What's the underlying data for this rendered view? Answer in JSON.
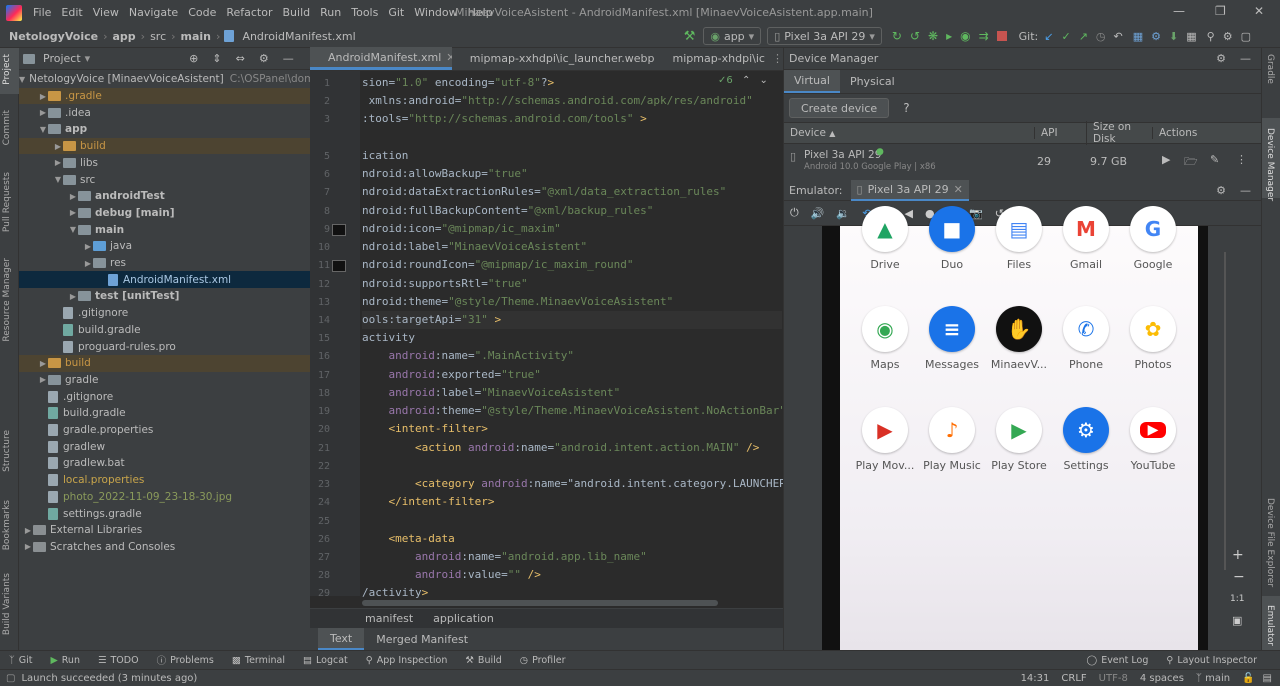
{
  "menubar": {
    "items": [
      "File",
      "Edit",
      "View",
      "Navigate",
      "Code",
      "Refactor",
      "Build",
      "Run",
      "Tools",
      "Git",
      "Window",
      "Help"
    ],
    "title": "MinaevVoiceAsistent - AndroidManifest.xml [MinaevVoiceAsistent.app.main]"
  },
  "navbar": {
    "crumbs": [
      "NetologyVoice",
      "app",
      "src",
      "main",
      "AndroidManifest.xml"
    ],
    "run_config": "app",
    "device": "Pixel 3a API 29",
    "git_label": "Git:"
  },
  "left_tools": [
    "Project",
    "Commit",
    "Pull Requests",
    "Resource Manager",
    "Structure",
    "Bookmarks",
    "Build Variants"
  ],
  "right_tools": [
    "Gradle",
    "Device Manager",
    "Device File Explorer",
    "Emulator"
  ],
  "project": {
    "header": "Project",
    "tree": [
      {
        "label": "NetologyVoice [MinaevVoiceAsistent]",
        "extra": "C:\\OSPanel\\doma",
        "indent": 0,
        "kind": "folder"
      },
      {
        "label": ".gradle",
        "indent": 1,
        "kind": "orange"
      },
      {
        "label": ".idea",
        "indent": 1,
        "kind": "folder"
      },
      {
        "label": "app",
        "indent": 1,
        "kind": "folder",
        "bold": true
      },
      {
        "label": "build",
        "indent": 2,
        "kind": "orange"
      },
      {
        "label": "libs",
        "indent": 2,
        "kind": "folder"
      },
      {
        "label": "src",
        "indent": 2,
        "kind": "folder"
      },
      {
        "label": "androidTest",
        "indent": 3,
        "kind": "folder",
        "bold": true
      },
      {
        "label": "debug [main]",
        "indent": 3,
        "kind": "folder",
        "bold": true
      },
      {
        "label": "main",
        "indent": 3,
        "kind": "folder",
        "bold": true
      },
      {
        "label": "java",
        "indent": 4,
        "kind": "blue"
      },
      {
        "label": "res",
        "indent": 4,
        "kind": "folder"
      },
      {
        "label": "AndroidManifest.xml",
        "indent": 5,
        "kind": "xml"
      },
      {
        "label": "test [unitTest]",
        "indent": 3,
        "kind": "folder",
        "bold": true
      },
      {
        "label": ".gitignore",
        "indent": 2,
        "kind": "file"
      },
      {
        "label": "build.gradle",
        "indent": 2,
        "kind": "grd"
      },
      {
        "label": "proguard-rules.pro",
        "indent": 2,
        "kind": "file"
      },
      {
        "label": "build",
        "indent": 1,
        "kind": "orange"
      },
      {
        "label": "gradle",
        "indent": 1,
        "kind": "folder"
      },
      {
        "label": ".gitignore",
        "indent": 1,
        "kind": "file"
      },
      {
        "label": "build.gradle",
        "indent": 1,
        "kind": "grd"
      },
      {
        "label": "gradle.properties",
        "indent": 1,
        "kind": "file"
      },
      {
        "label": "gradlew",
        "indent": 1,
        "kind": "file"
      },
      {
        "label": "gradlew.bat",
        "indent": 1,
        "kind": "file"
      },
      {
        "label": "local.properties",
        "indent": 1,
        "kind": "file",
        "color": "#c8a54b"
      },
      {
        "label": "photo_2022-11-09_23-18-30.jpg",
        "indent": 1,
        "kind": "file",
        "color": "#8a9a5b"
      },
      {
        "label": "settings.gradle",
        "indent": 1,
        "kind": "grd"
      },
      {
        "label": "External Libraries",
        "indent": 0,
        "kind": "lib"
      },
      {
        "label": "Scratches and Consoles",
        "indent": 0,
        "kind": "lib"
      }
    ]
  },
  "editor": {
    "tabs": [
      "AndroidManifest.xml",
      "mipmap-xxhdpi\\ic_launcher.webp",
      "mipmap-xhdpi\\ic"
    ],
    "warnings": "6",
    "lines": [
      "1",
      "2",
      "3",
      "",
      "5",
      "6",
      "7",
      "8",
      "9",
      "10",
      "11",
      "12",
      "13",
      "14",
      "15",
      "16",
      "17",
      "18",
      "19",
      "20",
      "21",
      "22",
      "23",
      "24",
      "25",
      "26",
      "27",
      "28",
      "29"
    ],
    "code": [
      "sion=\"1.0\" encoding=\"utf-8\"?>",
      " xmlns:android=\"http://schemas.android.com/apk/res/android\"",
      ":tools=\"http://schemas.android.com/tools\" >",
      "",
      "ication",
      "ndroid:allowBackup=\"true\"",
      "ndroid:dataExtractionRules=\"@xml/data_extraction_rules\"",
      "ndroid:fullBackupContent=\"@xml/backup_rules\"",
      "ndroid:icon=\"@mipmap/ic_maxim\"",
      "ndroid:label=\"MinaevVoiceAsistent\"",
      "ndroid:roundIcon=\"@mipmap/ic_maxim_round\"",
      "ndroid:supportsRtl=\"true\"",
      "ndroid:theme=\"@style/Theme.MinaevVoiceAsistent\"",
      "ools:targetApi=\"31\" >",
      "activity",
      "    android:name=\".MainActivity\"",
      "    android:exported=\"true\"",
      "    android:label=\"MinaevVoiceAsistent\"",
      "    android:theme=\"@style/Theme.MinaevVoiceAsistent.NoActionBar\"",
      "    <intent-filter>",
      "        <action android:name=\"android.intent.action.MAIN\" />",
      "",
      "        <category android:name=\"android.intent.category.LAUNCHER",
      "    </intent-filter>",
      "",
      "    <meta-data",
      "        android:name=\"android.app.lib_name\"",
      "        android:value=\"\" />",
      "/activity>"
    ],
    "breadcrumb": [
      "manifest",
      "application"
    ],
    "bottom_tabs": [
      "Text",
      "Merged Manifest"
    ]
  },
  "device_manager": {
    "title": "Device Manager",
    "tabs": [
      "Virtual",
      "Physical"
    ],
    "create_button": "Create device",
    "help": "?",
    "columns": [
      "Device",
      "API",
      "Size on Disk",
      "Actions"
    ],
    "device": {
      "name": "Pixel 3a API 29",
      "sub": "Android 10.0 Google Play | x86",
      "api": "29",
      "size": "9.7 GB"
    }
  },
  "emulator": {
    "label": "Emulator:",
    "tab": "Pixel 3a API 29",
    "apps": [
      {
        "name": "Drive",
        "color": "#1fa463",
        "glyph": "▲"
      },
      {
        "name": "Duo",
        "color": "#1a73e8",
        "glyph": "■"
      },
      {
        "name": "Files",
        "color": "#4285f4",
        "glyph": "▤"
      },
      {
        "name": "Gmail",
        "color": "#ea4335",
        "glyph": "M"
      },
      {
        "name": "Google",
        "color": "#4285f4",
        "glyph": "G"
      },
      {
        "name": "Maps",
        "color": "#34a853",
        "glyph": "◉"
      },
      {
        "name": "Messages",
        "color": "#1a73e8",
        "glyph": "≡"
      },
      {
        "name": "MinaevV...",
        "color": "#222222",
        "glyph": "✋"
      },
      {
        "name": "Phone",
        "color": "#1a73e8",
        "glyph": "✆"
      },
      {
        "name": "Photos",
        "color": "#fbbc04",
        "glyph": "✿"
      },
      {
        "name": "Play Mov...",
        "color": "#d93025",
        "glyph": "▶"
      },
      {
        "name": "Play Music",
        "color": "#ff6d00",
        "glyph": "♪"
      },
      {
        "name": "Play Store",
        "color": "#34a853",
        "glyph": "▶"
      },
      {
        "name": "Settings",
        "color": "#1a73e8",
        "glyph": "⚙"
      },
      {
        "name": "YouTube",
        "color": "#ff0000",
        "glyph": "▶"
      }
    ],
    "zoom_ratio": "1:1"
  },
  "statusbar": {
    "items": [
      "Git",
      "Run",
      "TODO",
      "Problems",
      "Terminal",
      "Logcat",
      "App Inspection",
      "Build",
      "Profiler"
    ],
    "right": [
      "Event Log",
      "Layout Inspector"
    ]
  },
  "bottombar": {
    "message": "Launch succeeded (3 minutes ago)",
    "position": "14:31",
    "line_sep": "CRLF",
    "encoding": "UTF-8",
    "indent": "4 spaces",
    "branch": "main"
  }
}
